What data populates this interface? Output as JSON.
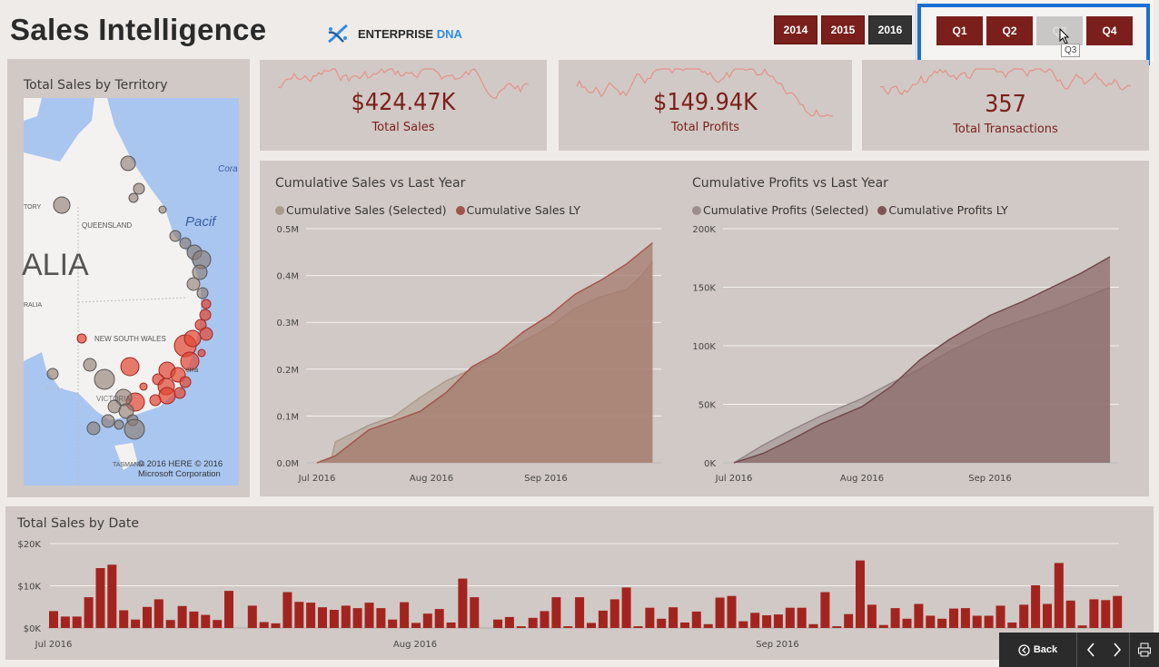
{
  "header": {
    "title": "Sales Intelligence",
    "logo_text": "ENTERPRISE",
    "logo_accent": "DNA"
  },
  "years": {
    "items": [
      "2014",
      "2015",
      "2016"
    ],
    "selected": "2016"
  },
  "quarters": {
    "items": [
      "Q1",
      "Q2",
      "Q3",
      "Q4"
    ],
    "hovered": "Q3",
    "tooltip": "Q3"
  },
  "colors": {
    "accent": "#7a1f1b",
    "panel": "#d1c9c5",
    "highlight_box": "#1a6fd1",
    "bar": "#a3241f",
    "selected_series": "#a89a8c",
    "ly_series": "#a0534a"
  },
  "map": {
    "title": "Total Sales by Territory",
    "labels": {
      "country": "ALIA",
      "state1": "QUEENSLAND",
      "state2": "NEW SOUTH WALES",
      "state3": "VICTORIA",
      "territory": "TORY",
      "wa": "RALIA",
      "tas": "TASMANIA",
      "ocean": "Pacif",
      "coral": "Cora",
      "city": "erra"
    },
    "copyright": "© 2016 HERE   © 2016 Microsoft Corporation"
  },
  "kpis": [
    {
      "value": "$424.47K",
      "label": "Total Sales"
    },
    {
      "value": "$149.94K",
      "label": "Total Profits"
    },
    {
      "value": "357",
      "label": "Total Transactions"
    }
  ],
  "chart_data": [
    {
      "type": "area",
      "title": "Cumulative Sales vs Last Year",
      "x_unit": "day of quarter (Jul 1 = 0)",
      "xticks": [
        "Jul 2016",
        "Aug 2016",
        "Sep 2016"
      ],
      "yticks": [
        "0.0M",
        "0.1M",
        "0.2M",
        "0.3M",
        "0.4M",
        "0.5M"
      ],
      "ylim": [
        0,
        0.5
      ],
      "series": [
        {
          "name": "Cumulative Sales (Selected)",
          "x": [
            0,
            4,
            5,
            14,
            21,
            28,
            35,
            42,
            49,
            56,
            63,
            70,
            77,
            84,
            88,
            91
          ],
          "y": [
            0,
            0.012,
            0.045,
            0.08,
            0.1,
            0.14,
            0.175,
            0.2,
            0.23,
            0.26,
            0.29,
            0.33,
            0.355,
            0.37,
            0.4,
            0.43
          ]
        },
        {
          "name": "Cumulative Sales LY",
          "x": [
            0,
            5,
            14,
            21,
            28,
            35,
            42,
            49,
            56,
            63,
            70,
            77,
            84,
            91
          ],
          "y": [
            0,
            0.015,
            0.07,
            0.09,
            0.11,
            0.15,
            0.205,
            0.235,
            0.28,
            0.315,
            0.36,
            0.39,
            0.425,
            0.47
          ]
        }
      ],
      "grid": true,
      "legend": "top-left"
    },
    {
      "type": "area",
      "title": "Cumulative Profits vs Last Year",
      "xticks": [
        "Jul 2016",
        "Aug 2016",
        "Sep 2016"
      ],
      "yticks": [
        "0K",
        "50K",
        "100K",
        "150K",
        "200K"
      ],
      "ylim": [
        0,
        200000
      ],
      "series": [
        {
          "name": "Cumulative Profits (Selected)",
          "x": [
            0,
            7,
            14,
            21,
            31,
            38,
            45,
            52,
            62,
            70,
            77,
            84,
            91
          ],
          "y": [
            0,
            15000,
            28000,
            40000,
            55000,
            68000,
            80000,
            95000,
            112000,
            122000,
            130000,
            140000,
            150000
          ]
        },
        {
          "name": "Cumulative Profits LY",
          "x": [
            0,
            7,
            14,
            21,
            31,
            38,
            45,
            52,
            62,
            70,
            77,
            84,
            91
          ],
          "y": [
            0,
            8000,
            20000,
            33000,
            48000,
            65000,
            88000,
            105000,
            126000,
            138000,
            150000,
            162000,
            176000
          ]
        }
      ],
      "grid": true,
      "legend": "top-left"
    },
    {
      "type": "bar",
      "title": "Total Sales by Date",
      "xticks": [
        "Jul 2016",
        "Aug 2016",
        "Sep 2016"
      ],
      "yticks": [
        "$0K",
        "$10K",
        "$20K"
      ],
      "ylim": [
        0,
        20
      ],
      "y_unit": "$K",
      "values": [
        4.0,
        2.7,
        2.7,
        7.3,
        14.2,
        15.0,
        4.2,
        2.0,
        5.0,
        6.8,
        1.9,
        5.2,
        3.9,
        3.1,
        1.9,
        8.8,
        0,
        5.3,
        1.4,
        1.1,
        8.5,
        6.2,
        6.0,
        4.9,
        4.3,
        5.3,
        4.7,
        6.0,
        4.7,
        2.0,
        6.1,
        1.2,
        3.4,
        4.5,
        1.3,
        11.7,
        7.3,
        0,
        2.0,
        2.6,
        0.4,
        2.4,
        4.0,
        7.3,
        0.4,
        7.3,
        1.2,
        4.1,
        6.8,
        9.6,
        0.4,
        4.8,
        2.2,
        4.9,
        1.3,
        3.9,
        0.9,
        7.2,
        7.6,
        1.6,
        3.6,
        3.0,
        3.2,
        4.8,
        4.8,
        0.9,
        8.5,
        0.4,
        3.3,
        16.0,
        5.5,
        0.7,
        4.7,
        2.2,
        5.7,
        2.9,
        2.2,
        4.6,
        4.7,
        2.9,
        2.9,
        5.3,
        1.3,
        5.5,
        10.1,
        5.7,
        15.4,
        6.5,
        0.6,
        6.8,
        6.6,
        7.6
      ],
      "grid": true
    }
  ],
  "nav": {
    "back": "Back"
  }
}
